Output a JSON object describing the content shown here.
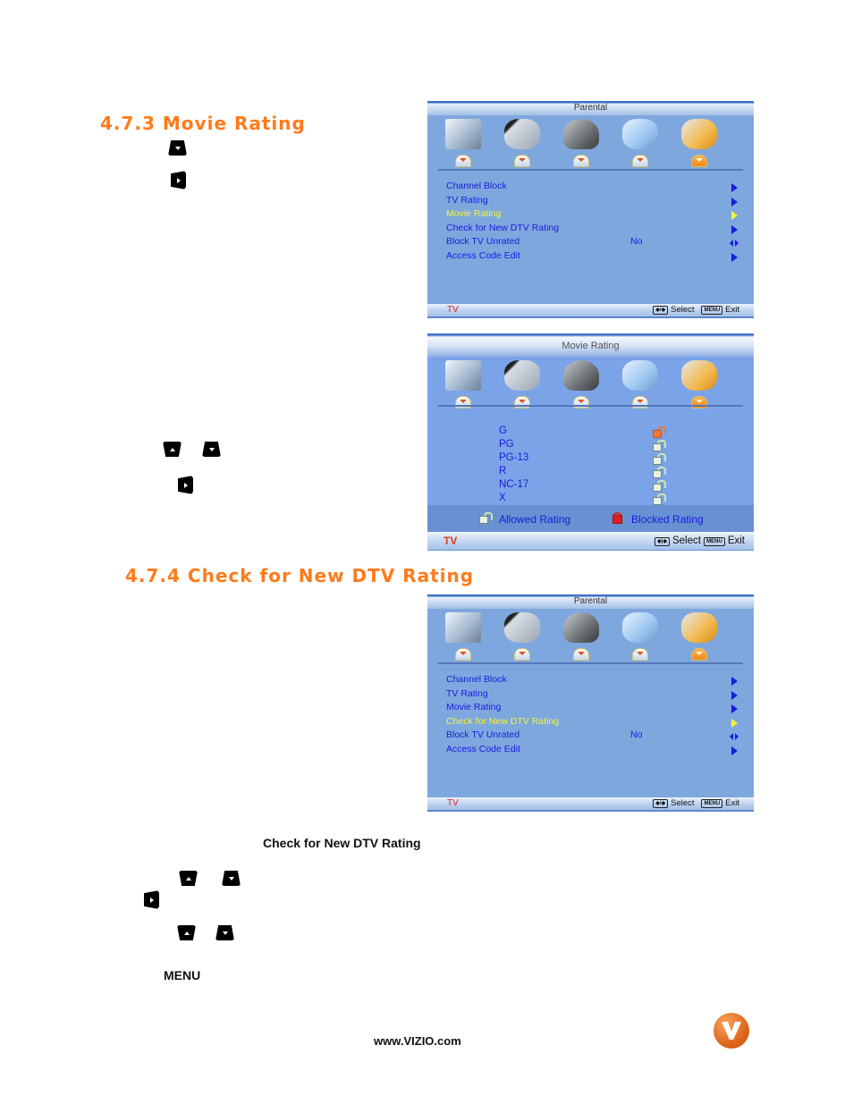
{
  "section_473": {
    "heading": "4.7.3  Movie Rating"
  },
  "section_474": {
    "heading": "4.7.4 Check for New DTV Rating",
    "instruction_label": "Check for New DTV Rating",
    "menu_label": "MENU"
  },
  "remote_keys": {
    "up": "up-arrow-key",
    "down": "down-arrow-key",
    "right": "right-arrow-key"
  },
  "osd_parental": {
    "title": "Parental",
    "icons": [
      "tv-picture-icon",
      "microphone-audio-icon",
      "satellite-dish-tv-icon",
      "wrench-setup-icon",
      "key-parental-icon"
    ],
    "active_icon_index": 4,
    "menu_items": [
      {
        "label": "Channel Block",
        "value": "",
        "control": "arrow"
      },
      {
        "label": "TV Rating",
        "value": "",
        "control": "arrow"
      },
      {
        "label": "Movie Rating",
        "value": "",
        "control": "arrow"
      },
      {
        "label": "Check for New DTV Rating",
        "value": "",
        "control": "arrow"
      },
      {
        "label": "Block TV Unrated",
        "value": "No",
        "control": "left-right"
      },
      {
        "label": "Access Code Edit",
        "value": "",
        "control": "arrow"
      }
    ],
    "source": "TV",
    "hint_select": "Select",
    "hint_menu_badge": "MENU",
    "hint_exit": "Exit",
    "hint_nav_badge": "◆/◆"
  },
  "screen1": {
    "selected_index": 2
  },
  "screen3": {
    "selected_index": 3
  },
  "osd_movie_rating": {
    "title": "Movie  Rating",
    "ratings": [
      {
        "label": "G",
        "state": "allowed-selected"
      },
      {
        "label": "PG",
        "state": "allowed"
      },
      {
        "label": "PG-13",
        "state": "allowed"
      },
      {
        "label": "R",
        "state": "allowed"
      },
      {
        "label": "NC-17",
        "state": "allowed"
      },
      {
        "label": "X",
        "state": "allowed"
      }
    ],
    "legend_allowed": "Allowed  Rating",
    "legend_blocked": "Blocked  Rating",
    "source": "TV",
    "hint_select": "Select",
    "hint_menu_badge": "MENU",
    "hint_exit": "Exit"
  },
  "page_footer": {
    "url": "www.VIZIO.com",
    "logo": "vizio-v-logo"
  },
  "colors": {
    "heading_orange": "#ff7a1a",
    "osd_blue": "#7ea7de",
    "menu_text": "#1a1ae0",
    "menu_selected": "#f5f53a",
    "source_red": "#e0201e"
  }
}
